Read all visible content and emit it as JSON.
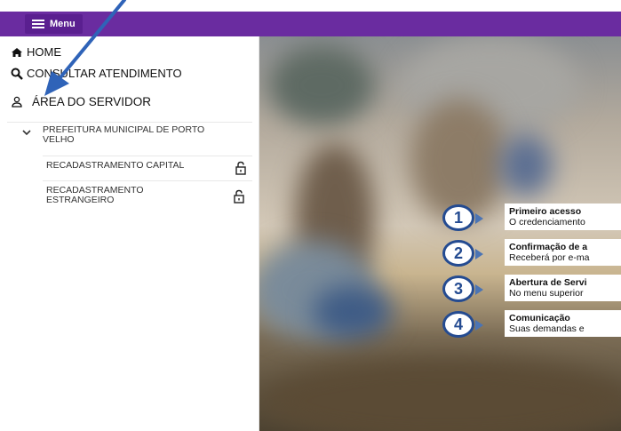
{
  "topbar": {
    "menu_label": "Menu"
  },
  "sidebar": {
    "home_label": "HOME",
    "consult_label": "CONSULTAR ATENDIMENTO",
    "servidor_label": "ÁREA DO SERVIDOR",
    "tree_parent_label": "PREFEITURA MUNICIPAL DE PORTO VELHO",
    "items": [
      {
        "label": "RECADASTRAMENTO CAPITAL"
      },
      {
        "label": "RECADASTRAMENTO ESTRANGEIRO"
      }
    ]
  },
  "steps": [
    {
      "number": "1",
      "title": "Primeiro acesso",
      "text": "O credenciamento"
    },
    {
      "number": "2",
      "title": "Confirmação de a",
      "text": "Receberá por e-ma"
    },
    {
      "number": "3",
      "title": "Abertura de Servi",
      "text": "No menu superior"
    },
    {
      "number": "4",
      "title": "Comunicação",
      "text": "Suas demandas e"
    }
  ],
  "colors": {
    "topbar": "#6a2ca0",
    "step_accent": "#244b91",
    "annotation_arrow": "#2f63b8"
  }
}
